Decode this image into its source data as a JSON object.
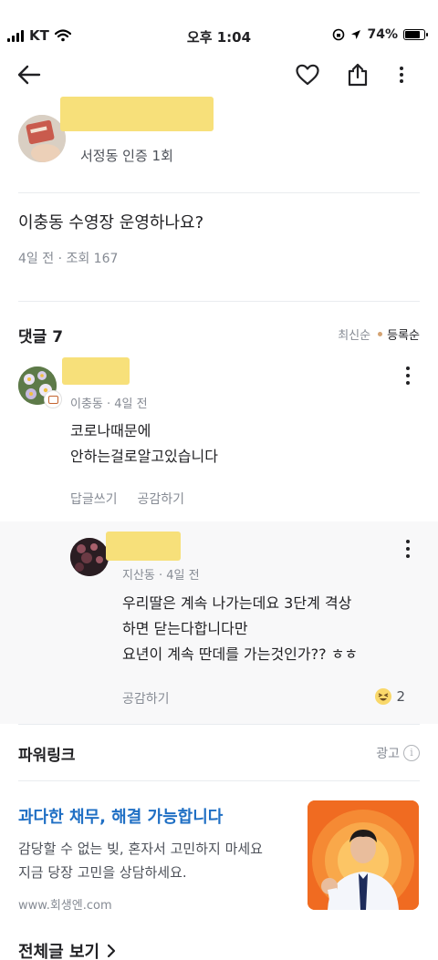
{
  "status_bar": {
    "carrier": "KT",
    "time": "오후 1:04",
    "battery": "74%",
    "battery_level": 0.74
  },
  "nav": {
    "icons": [
      "back-arrow-icon",
      "heart-icon",
      "share-icon",
      "more-icon"
    ]
  },
  "post": {
    "author_meta": "서정동 인증 1회",
    "title": "이충동 수영장 운영하나요?",
    "meta": "4일 전 · 조회 167"
  },
  "comments": {
    "header": "댓글 7",
    "sort_latest": "최신순",
    "sort_registered": "등록순",
    "items": [
      {
        "meta": "이충동 · 4일 전",
        "text": "코로나때문에\n안하는걸로알고있습니다",
        "reply_label": "답글쓰기",
        "like_label": "공감하기"
      }
    ],
    "reply": {
      "meta": "지산동 · 4일 전",
      "text": "우리딸은 계속 나가는데요 3단계 격상\n하면 닫는다합니다만\n요년이 계속 딴데를 가는것인가?? ㅎㅎ",
      "like_label": "공감하기",
      "reaction_count": "2"
    }
  },
  "power_link": {
    "title": "파워링크",
    "ad_label": "광고",
    "info_icon": "i",
    "headline": "과다한 채무, 해결 가능합니다",
    "description": "감당할 수 없는 빚, 혼자서 고민하지 마세요\n지금 당장 고민을 상담하세요.",
    "url": "www.회생엔.com"
  },
  "footer": {
    "all_posts": "전체글 보기"
  },
  "colors": {
    "accent_link": "#1f6fc4",
    "muted_text": "#868b94",
    "redaction": "#f7e07a",
    "ad_bg": "#f27a2a"
  }
}
